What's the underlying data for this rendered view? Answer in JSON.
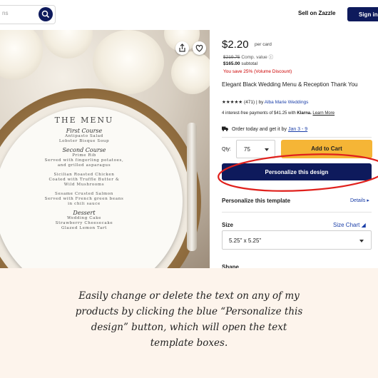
{
  "header": {
    "search_placeholder": "ns",
    "sell_label": "Sell on Zazzle",
    "signin_label": "Sign in",
    "icons": [
      "search-icon"
    ]
  },
  "product_image": {
    "menu": {
      "title": "THE MENU",
      "courses": [
        {
          "name": "First Course",
          "items": [
            "Antipasto Salad",
            "Lobster Bisque Soup"
          ]
        },
        {
          "name": "Second Course",
          "items": [
            "Prime Rib",
            "Served with fingerling potatoes,",
            "and grilled asparagus",
            "",
            "Sicilian Roasted Chicken",
            "Coated with Truffle Butter &",
            "Wild Mushrooms",
            "",
            "Sesame Crusted Salmon",
            "Served with French green beans",
            "in chili sauce"
          ]
        },
        {
          "name": "Dessert",
          "items": [
            "Wedding Cake",
            "Strawberry Cheesecake",
            "Glazed Lemon Tart"
          ]
        }
      ]
    },
    "icons": [
      "share-icon",
      "heart-icon"
    ]
  },
  "product": {
    "price": "$2.20",
    "per_card": "per card",
    "comp_value": "$219.75",
    "comp_label": "Comp. value",
    "subtotal_value": "$165.00",
    "subtotal_label": "subtotal",
    "savings": "You save 25% (Volume Discount)",
    "title": "Elegant Black Wedding Menu & Reception Thank You",
    "stars": "★★★★★",
    "reviews": "(471)",
    "by": "| by",
    "seller": "Alba Marie Weddings",
    "klarna_text": "4 interest-free payments of $41.25 with",
    "klarna_brand": "Klarna.",
    "learn_more": "Learn More",
    "order_text": "Order today and get it by",
    "order_date": "Jan 3 - 9"
  },
  "purchase": {
    "qty_label": "Qty:",
    "qty_value": "75",
    "add_to_cart": "Add to Cart",
    "personalize": "Personalize this design",
    "highlight_color": "#e0201c"
  },
  "options": {
    "personalize_template": "Personalize this template",
    "details": "Details",
    "size_label": "Size",
    "size_chart": "Size Chart",
    "size_value": "5.25\" x 5.25\"",
    "shape_label": "Shape"
  },
  "caption": {
    "text": "Easily change or delete the text on any of my products by clicking the blue “Personalize this design” button, which will open the text template boxes."
  },
  "colors": {
    "navy": "#0e1a5c",
    "cart_yellow": "#f5b536",
    "link_blue": "#1a3ea8",
    "save_red": "#cc0000",
    "caption_bg": "#fdf4ec"
  }
}
